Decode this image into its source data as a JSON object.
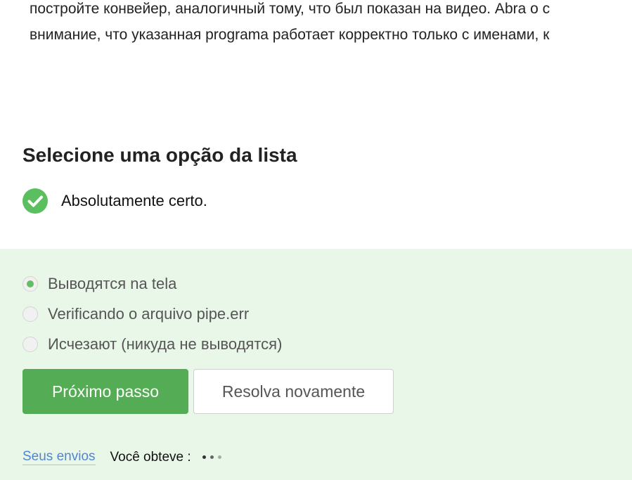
{
  "lesson": {
    "lines": [
      "постройте конвейер, аналогичный тому, что был показан на видео. Abra o с",
      "внимание, что указанная programa работает корректно только с именами, к"
    ]
  },
  "quiz": {
    "title": "Selecione uma opção da lista",
    "feedback": {
      "icon": "check-circle-icon",
      "color": "#5cbf5f",
      "text": "Absolutamente certo."
    },
    "options": [
      {
        "label": "Выводятся na tela",
        "selected": true
      },
      {
        "label": "Verificando o arquivo pipe.err",
        "selected": false
      },
      {
        "label": "Исчезают (никуда не выводятся)",
        "selected": false
      }
    ],
    "buttons": {
      "next": "Próximo passo",
      "retry": "Resolva novamente"
    },
    "footer": {
      "submissions_link": "Seus envios",
      "score_label": "Você obteve :"
    }
  },
  "colors": {
    "panel_bg": "#e9f7e9",
    "primary_button": "#54ad54",
    "link": "#4f84d6"
  }
}
